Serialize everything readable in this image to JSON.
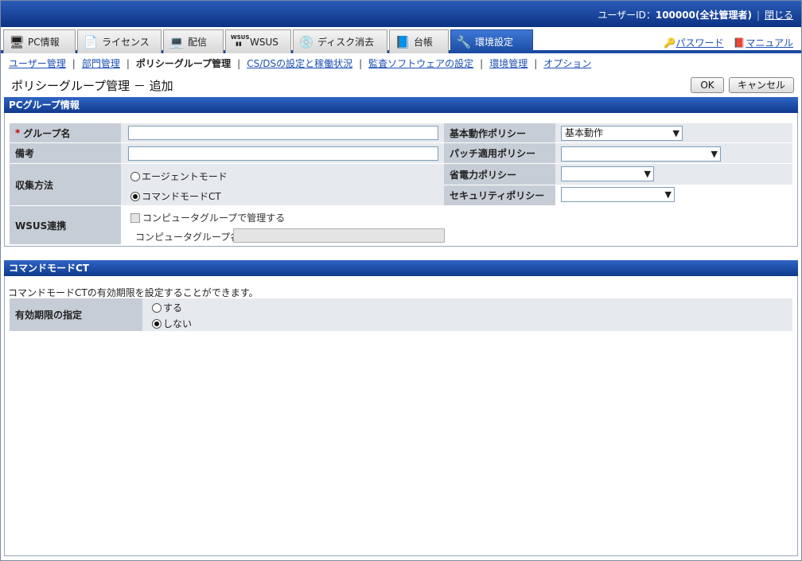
{
  "header": {
    "user_prefix": "ユーザーID：",
    "user_value": "100000(全社管理者)",
    "separator": "|",
    "close_label": "閉じる"
  },
  "tabs": [
    {
      "label": "PC情報",
      "icon": "pc-icon"
    },
    {
      "label": "ライセンス",
      "icon": "license-icon"
    },
    {
      "label": "配信",
      "icon": "distribution-icon"
    },
    {
      "label": "WSUS",
      "icon": "wsus-icon",
      "badge": "WSUS"
    },
    {
      "label": "ディスク消去",
      "icon": "disk-erase-icon"
    },
    {
      "label": "台帳",
      "icon": "ledger-icon"
    },
    {
      "label": "環境設定",
      "icon": "settings-tools-icon",
      "active": true
    }
  ],
  "right_links": {
    "password": "パスワード",
    "manual": "マニュアル"
  },
  "subnav": {
    "items": [
      {
        "label": "ユーザー管理",
        "link": true
      },
      {
        "label": "部門管理",
        "link": true
      },
      {
        "label": "ポリシーグループ管理",
        "link": false
      },
      {
        "label": "CS/DSの設定と稼働状況",
        "link": true
      },
      {
        "label": "監査ソフトウェアの設定",
        "link": true
      },
      {
        "label": "環境管理",
        "link": true
      },
      {
        "label": "オプション",
        "link": true
      }
    ],
    "separator": "|"
  },
  "page": {
    "title": "ポリシーグループ管理 － 追加",
    "ok_label": "OK",
    "cancel_label": "キャンセル"
  },
  "pc_group": {
    "header": "PCグループ情報",
    "required_mark": "*",
    "group_name_label": "グループ名",
    "group_name_value": "",
    "note_label": "備考",
    "note_value": "",
    "collect_label": "収集方法",
    "collect_options": [
      "エージェントモード",
      "コマンドモードCT"
    ],
    "collect_selected": "コマンドモードCT",
    "wsus_label": "WSUS連携",
    "wsus_checkbox_label": "コンピュータグループで管理する",
    "wsus_group_name_label": "コンピュータグループ名",
    "basic_policy_label": "基本動作ポリシー",
    "basic_policy_value": "基本動作",
    "patch_policy_label": "パッチ適用ポリシー",
    "patch_policy_value": "",
    "power_policy_label": "省電力ポリシー",
    "power_policy_value": "",
    "security_policy_label": "セキュリティポリシー",
    "security_policy_value": ""
  },
  "command_mode": {
    "header": "コマンドモードCT",
    "description": "コマンドモードCTの有効期限を設定することができます。",
    "expiry_label": "有効期限の指定",
    "expiry_options": [
      "する",
      "しない"
    ],
    "expiry_selected": "しない"
  },
  "colors": {
    "header_blue": "#0c3283",
    "label_bg": "#c7cdd6",
    "link_blue": "#1d4fb5"
  }
}
